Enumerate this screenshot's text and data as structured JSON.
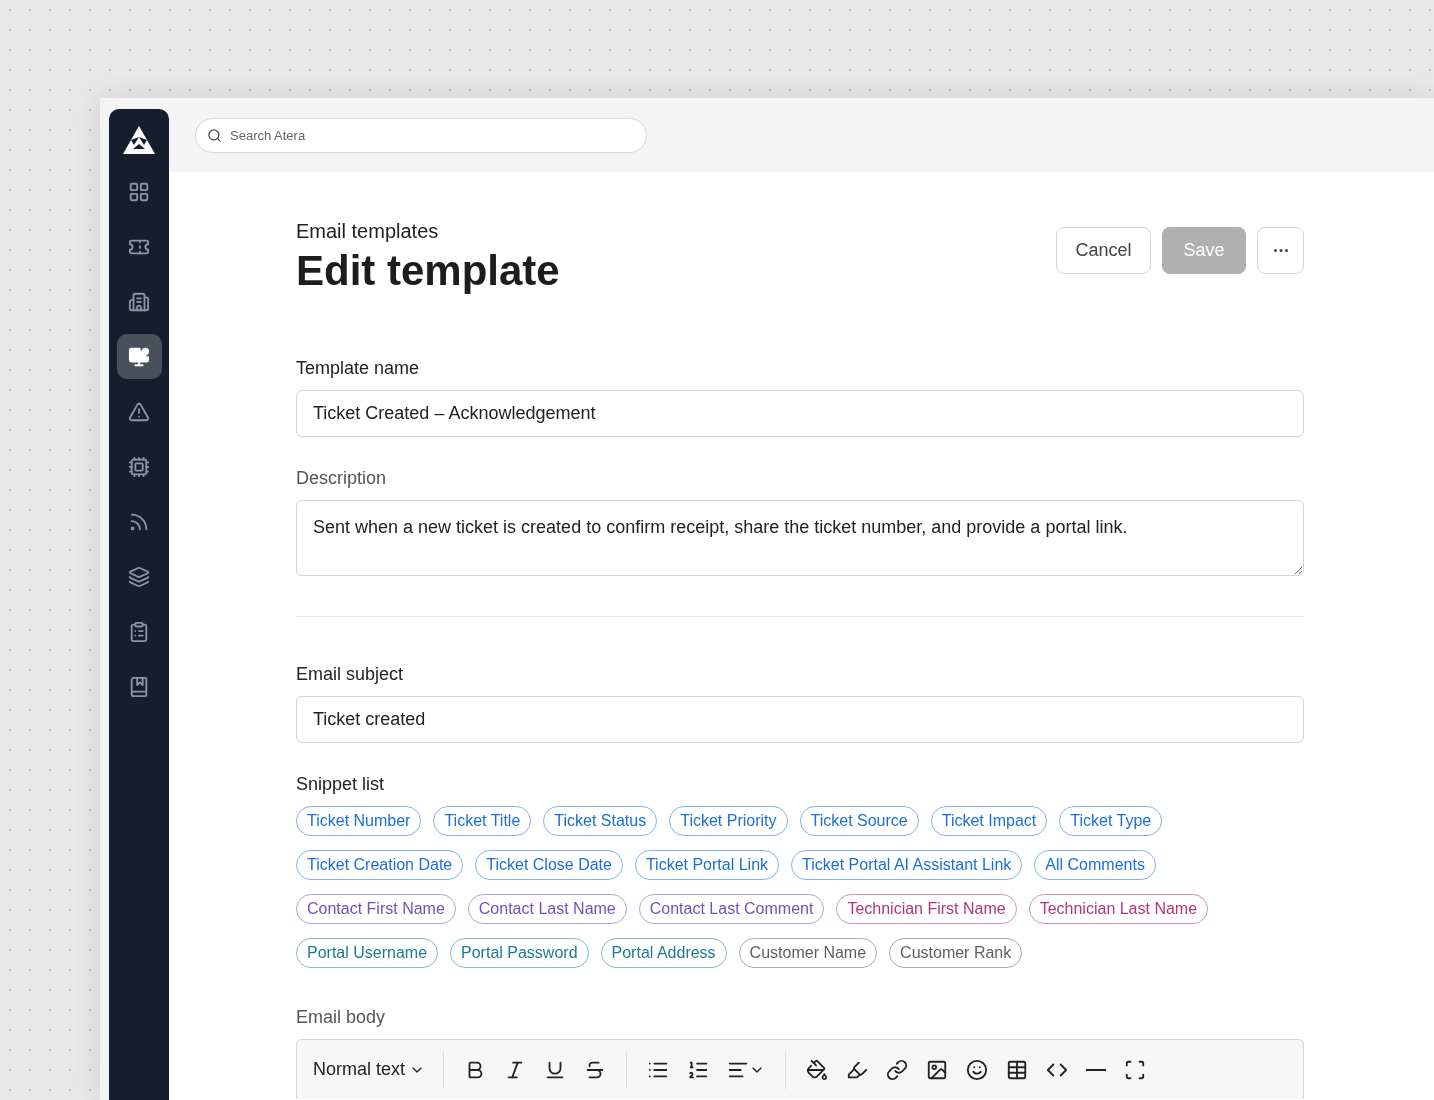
{
  "search": {
    "placeholder": "Search Atera"
  },
  "sidebar": {
    "items": [
      {
        "kind": "dashboard",
        "selected": false
      },
      {
        "kind": "tickets",
        "selected": false
      },
      {
        "kind": "customers",
        "selected": false
      },
      {
        "kind": "devices",
        "selected": true
      },
      {
        "kind": "alerts",
        "selected": false
      },
      {
        "kind": "patch",
        "selected": false
      },
      {
        "kind": "network",
        "selected": false
      },
      {
        "kind": "apps",
        "selected": false
      },
      {
        "kind": "reports",
        "selected": false
      },
      {
        "kind": "knowledge",
        "selected": false
      }
    ]
  },
  "header": {
    "breadcrumb": "Email templates",
    "title": "Edit template",
    "buttons": [
      {
        "kind": "secondary",
        "label": "Cancel",
        "disabled": false
      },
      {
        "kind": "primary",
        "label": "Save",
        "disabled": true
      },
      {
        "kind": "more",
        "disabled": false
      }
    ]
  },
  "template_name": {
    "label": "Template name",
    "value": "Ticket Created – Acknowledgement"
  },
  "description": {
    "label": "Description",
    "value": "Sent when a new ticket is created to confirm receipt, share the ticket number, and provide a portal link."
  },
  "email_subject": {
    "label": "Email subject",
    "value": "Ticket created"
  },
  "snippet_list": {
    "label": "Snippet list",
    "snippets": [
      {
        "label": "Ticket Number",
        "color": "#1a6fd6"
      },
      {
        "label": "Ticket Title",
        "color": "#1a6fd6"
      },
      {
        "label": "Ticket Status",
        "color": "#1a6fd6"
      },
      {
        "label": "Ticket Priority",
        "color": "#1a6fd6"
      },
      {
        "label": "Ticket Source",
        "color": "#1a6fd6"
      },
      {
        "label": "Ticket Impact",
        "color": "#1a6fd6"
      },
      {
        "label": "Ticket Type",
        "color": "#1a6fd6"
      },
      {
        "label": "Ticket Creation Date",
        "color": "#1a6fd6"
      },
      {
        "label": "Ticket Close Date",
        "color": "#1a6fd6"
      },
      {
        "label": "Ticket Portal Link",
        "color": "#1a6fd6"
      },
      {
        "label": "Ticket Portal AI Assistant Link",
        "color": "#1a6fd6"
      },
      {
        "label": "All Comments",
        "color": "#1a6fd6"
      },
      {
        "label": "Contact First Name",
        "color": "#7450b8"
      },
      {
        "label": "Contact Last Name",
        "color": "#7450b8"
      },
      {
        "label": "Contact Last Comment",
        "color": "#7450b8"
      },
      {
        "label": "Technician First Name",
        "color": "#b0357e"
      },
      {
        "label": "Technician Last Name",
        "color": "#b0357e"
      },
      {
        "label": "Portal Username",
        "color": "#1d7a8c"
      },
      {
        "label": "Portal Password",
        "color": "#1d7a8c"
      },
      {
        "label": "Portal Address",
        "color": "#1d7a8c"
      },
      {
        "label": "Customer Name",
        "color": "#5f5f5f"
      },
      {
        "label": "Customer Rank",
        "color": "#5f5f5f"
      }
    ]
  },
  "email_body": {
    "label": "Email body",
    "text_style": "Normal text",
    "tools": [
      {
        "kind": "bold"
      },
      {
        "kind": "italic"
      },
      {
        "kind": "underline"
      },
      {
        "kind": "strike"
      },
      {
        "kind": "separator"
      },
      {
        "kind": "bullets"
      },
      {
        "kind": "numbers"
      },
      {
        "kind": "align"
      },
      {
        "kind": "separator"
      },
      {
        "kind": "textcolor"
      },
      {
        "kind": "highlight"
      },
      {
        "kind": "link"
      },
      {
        "kind": "image"
      },
      {
        "kind": "emoji"
      },
      {
        "kind": "table"
      },
      {
        "kind": "code"
      },
      {
        "kind": "rule"
      },
      {
        "kind": "fullscreen"
      }
    ]
  }
}
